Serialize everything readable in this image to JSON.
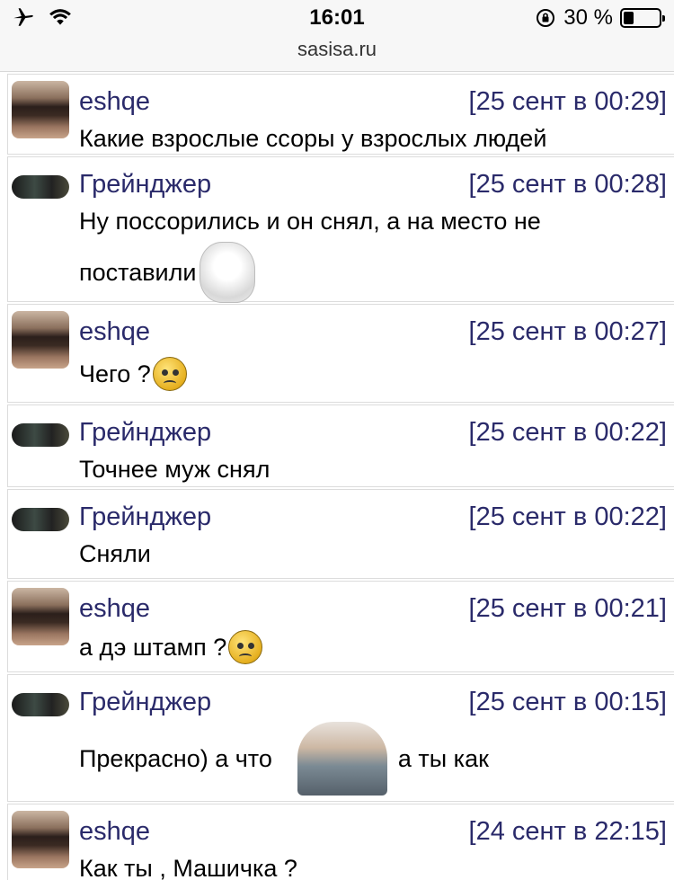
{
  "status_bar": {
    "time": "16:01",
    "battery_percent": "30 %",
    "battery_level": 0.3,
    "url": "sasisa.ru"
  },
  "messages": [
    {
      "author": "eshqe",
      "timestamp": "[25 сент в 00:29]",
      "text": "Какие взрослые ссоры у взрослых людей",
      "avatar": "big"
    },
    {
      "author": "Грейнджер",
      "timestamp": "[25 сент в 00:28]",
      "text_line1": "Ну поссорились и он снял, а на место не",
      "text_line2": "поставили",
      "attachment": "rage-face-meme",
      "avatar": "small"
    },
    {
      "author": "eshqe",
      "timestamp": "[25 сент в 00:27]",
      "text": "Чего ?",
      "attachment": "sad-smiley-emoji",
      "avatar": "big"
    },
    {
      "author": "Грейнджер",
      "timestamp": "[25 сент в 00:22]",
      "text": "Точнее муж снял",
      "avatar": "small"
    },
    {
      "author": "Грейнджер",
      "timestamp": "[25 сент в 00:22]",
      "text": "Сняли",
      "avatar": "small"
    },
    {
      "author": "eshqe",
      "timestamp": "[25 сент в 00:21]",
      "text": "а дэ штамп ?",
      "attachment": "sad-smiley-emoji",
      "avatar": "big"
    },
    {
      "author": "Грейнджер",
      "timestamp": "[25 сент в 00:15]",
      "text_before": "Прекрасно) а что",
      "text_after": "а ты как",
      "attachment": "harold-sticker",
      "avatar": "small"
    },
    {
      "author": "eshqe",
      "timestamp": "[24 сент в 22:15]",
      "text": "Как ты , Машичка ?",
      "avatar": "big"
    }
  ]
}
